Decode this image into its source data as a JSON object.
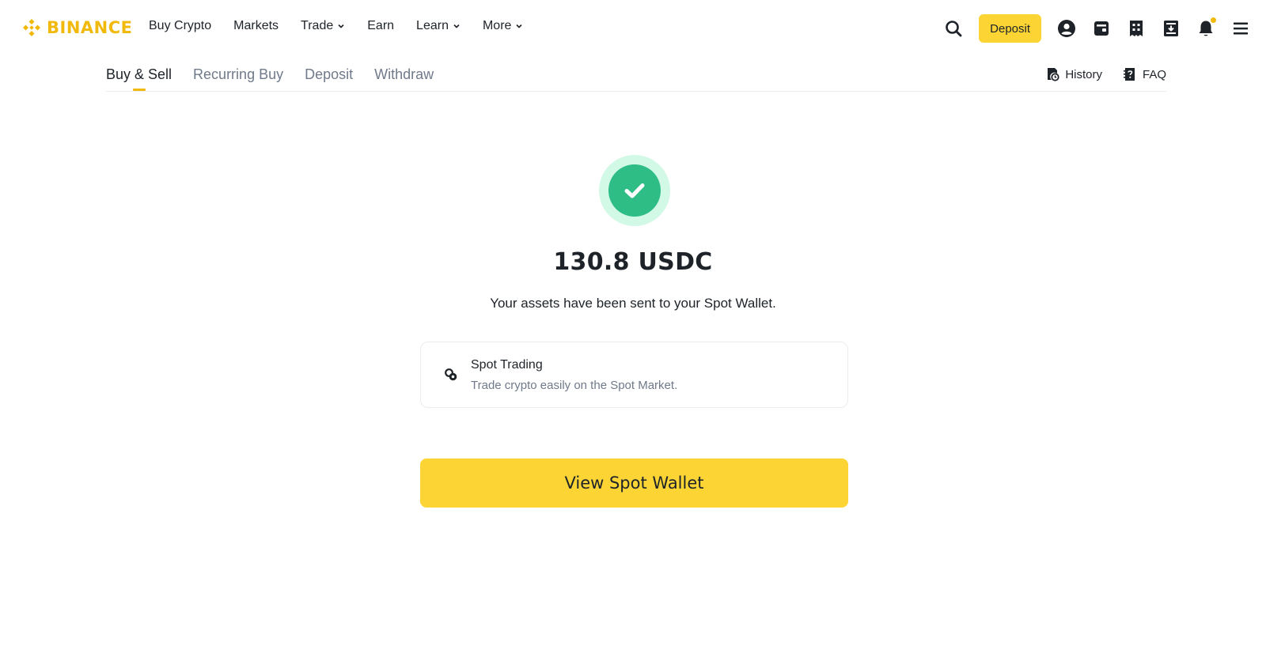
{
  "brand": {
    "name": "BINANCE",
    "color": "#F0B90B"
  },
  "topnav": {
    "links": [
      {
        "label": "Buy Crypto",
        "dropdown": false
      },
      {
        "label": "Markets",
        "dropdown": false
      },
      {
        "label": "Trade",
        "dropdown": true
      },
      {
        "label": "Earn",
        "dropdown": false
      },
      {
        "label": "Learn",
        "dropdown": true
      },
      {
        "label": "More",
        "dropdown": true
      }
    ],
    "deposit_label": "Deposit",
    "icons": [
      "search-icon",
      "user-icon",
      "wallet-icon",
      "orders-icon",
      "download-icon",
      "bell-icon",
      "menu-icon"
    ]
  },
  "subnav": {
    "tabs": [
      {
        "label": "Buy & Sell",
        "active": true
      },
      {
        "label": "Recurring Buy",
        "active": false
      },
      {
        "label": "Deposit",
        "active": false
      },
      {
        "label": "Withdraw",
        "active": false
      }
    ],
    "history_label": "History",
    "faq_label": "FAQ"
  },
  "result": {
    "amount": "130.8 USDC",
    "message": "Your assets have been sent to your Spot Wallet.",
    "status_color": "#2EBD85",
    "card": {
      "title": "Spot Trading",
      "description": "Trade crypto easily on the Spot Market.",
      "icon": "spot-trading-icon"
    },
    "primary_button": "View Spot Wallet"
  },
  "colors": {
    "accent": "#FCD535",
    "text": "#1E2329",
    "muted": "#707A8A"
  }
}
